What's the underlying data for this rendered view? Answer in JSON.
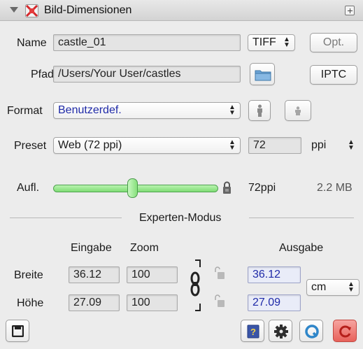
{
  "panel": {
    "title": "Bild-Dimensionen"
  },
  "name_row": {
    "label": "Name",
    "value": "castle_01",
    "format_select": "TIFF",
    "options_button": "Opt."
  },
  "path_row": {
    "label": "Pfad",
    "value": "/Users/Your User/castles",
    "iptc_button": "IPTC"
  },
  "format_row": {
    "label": "Format",
    "value": "Benutzerdef."
  },
  "preset_row": {
    "label": "Preset",
    "value": "Web (72 ppi)",
    "resolution_value": "72",
    "unit_select": "ppi"
  },
  "resolution_row": {
    "label": "Aufl.",
    "slider_fraction": 0.48,
    "value_text": "72ppi",
    "file_size": "2.2 MB"
  },
  "expert": {
    "section_title": "Experten-Modus",
    "col_input": "Eingabe",
    "col_zoom": "Zoom",
    "col_output": "Ausgabe",
    "width": {
      "label": "Breite",
      "input": "36.12",
      "zoom": "100",
      "output": "36.12"
    },
    "height": {
      "label": "Höhe",
      "input": "27.09",
      "zoom": "100",
      "output": "27.09"
    },
    "unit_select": "cm"
  },
  "colors": {
    "accent_blue": "#1f2aa8",
    "slider_green": "#7fdc74"
  },
  "icons": [
    "disclosure-triangle-icon",
    "app-icon",
    "collapse-icon",
    "folder-icon",
    "portrait-icon",
    "landscape-icon",
    "lock-icon",
    "chain-link-icon",
    "save-icon",
    "help-icon",
    "settings-gear-icon",
    "preview-icon",
    "reset-icon"
  ]
}
